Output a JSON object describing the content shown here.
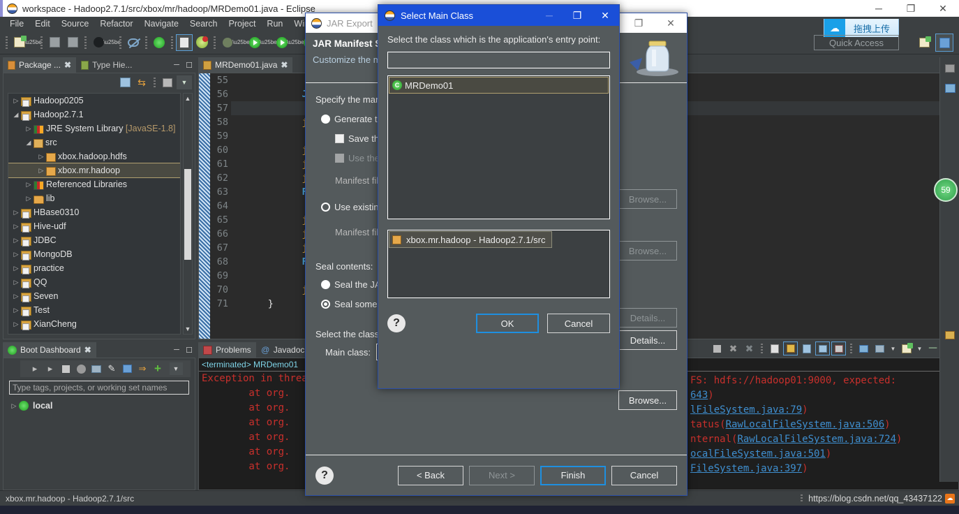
{
  "window": {
    "title": "workspace - Hadoop2.7.1/src/xbox/mr/hadoop/MRDemo01.java - Eclipse",
    "minimize": "─",
    "restore": "❐",
    "close": "✕"
  },
  "menu": [
    "File",
    "Edit",
    "Source",
    "Refactor",
    "Navigate",
    "Search",
    "Project",
    "Run",
    "Wind"
  ],
  "quick_access": {
    "label": "Quick Access"
  },
  "baidu_chip": {
    "label": "拖拽上传",
    "icon": "cloud-icon"
  },
  "badge": {
    "value": "59"
  },
  "package_explorer": {
    "tabs": [
      {
        "label": "Package ...",
        "active": true,
        "close": "✖"
      },
      {
        "label": "Type Hie...",
        "active": false
      }
    ],
    "tree": [
      {
        "indent": 0,
        "arrow": "▷",
        "icon": "project-icon",
        "label": "Hadoop0205",
        "selected": false
      },
      {
        "indent": 0,
        "arrow": "◢",
        "icon": "project-icon",
        "label": "Hadoop2.7.1",
        "selected": false
      },
      {
        "indent": 1,
        "arrow": "▷",
        "icon": "library-icon",
        "label": "JRE System Library ",
        "dim": "[JavaSE-1.8]",
        "selected": false
      },
      {
        "indent": 1,
        "arrow": "◢",
        "icon": "source-folder-icon",
        "label": "src",
        "selected": false
      },
      {
        "indent": 2,
        "arrow": "▷",
        "icon": "package-icon",
        "label": "xbox.hadoop.hdfs",
        "selected": false
      },
      {
        "indent": 2,
        "arrow": "▷",
        "icon": "package-icon",
        "label": "xbox.mr.hadoop",
        "selected": true
      },
      {
        "indent": 1,
        "arrow": "▷",
        "icon": "library-icon",
        "label": "Referenced Libraries",
        "selected": false
      },
      {
        "indent": 1,
        "arrow": "▷",
        "icon": "folder-icon",
        "label": "lib",
        "selected": false
      },
      {
        "indent": 0,
        "arrow": "▷",
        "icon": "project-icon",
        "label": "HBase0310",
        "selected": false
      },
      {
        "indent": 0,
        "arrow": "▷",
        "icon": "project-icon",
        "label": "Hive-udf",
        "selected": false
      },
      {
        "indent": 0,
        "arrow": "▷",
        "icon": "project-icon",
        "label": "JDBC",
        "selected": false
      },
      {
        "indent": 0,
        "arrow": "▷",
        "icon": "project-icon",
        "label": "MongoDB",
        "selected": false
      },
      {
        "indent": 0,
        "arrow": "▷",
        "icon": "project-icon",
        "label": "practice",
        "selected": false
      },
      {
        "indent": 0,
        "arrow": "▷",
        "icon": "project-icon",
        "label": "QQ",
        "selected": false
      },
      {
        "indent": 0,
        "arrow": "▷",
        "icon": "project-icon",
        "label": "Seven",
        "selected": false
      },
      {
        "indent": 0,
        "arrow": "▷",
        "icon": "project-icon",
        "label": "Test",
        "selected": false
      },
      {
        "indent": 0,
        "arrow": "▷",
        "icon": "project-icon",
        "label": "XianCheng",
        "selected": false
      }
    ]
  },
  "boot_dashboard": {
    "tab_label": "Boot Dashboard",
    "tab_close": "✖",
    "filter_placeholder": "Type tags, projects, or working set names",
    "items": [
      {
        "arrow": "▷",
        "label": "local"
      }
    ]
  },
  "editor": {
    "tab_label": "MRDemo01.java",
    "tab_close": "✖",
    "lines": [
      {
        "n": "55",
        "text": "",
        "hl": false
      },
      {
        "n": "56",
        "text": "Job",
        "kind": "kw",
        "hl": false
      },
      {
        "n": "57",
        "text": "",
        "hl": true
      },
      {
        "n": "58",
        "text": "job",
        "kind": "id",
        "hl": false
      },
      {
        "n": "59",
        "text": "",
        "hl": false
      },
      {
        "n": "60",
        "text": "job",
        "kind": "id",
        "hl": false
      },
      {
        "n": "61",
        "text": "job",
        "kind": "id",
        "hl": false
      },
      {
        "n": "62",
        "text": "job",
        "kind": "id",
        "hl": false
      },
      {
        "n": "63",
        "text": "Fil",
        "kind": "kw",
        "hl": false
      },
      {
        "n": "64",
        "text": "",
        "hl": false
      },
      {
        "n": "65",
        "text": "job",
        "kind": "id",
        "hl": false
      },
      {
        "n": "66",
        "text": "job",
        "kind": "id",
        "hl": false
      },
      {
        "n": "67",
        "text": "job",
        "kind": "id",
        "hl": false
      },
      {
        "n": "68",
        "text": "Fil",
        "kind": "kw",
        "hl": false
      },
      {
        "n": "69",
        "text": "",
        "hl": false
      },
      {
        "n": "70",
        "text": "job",
        "kind": "id",
        "hl": false
      },
      {
        "n": "71",
        "text": "}",
        "kind": "pl",
        "hl": false
      }
    ]
  },
  "console": {
    "tabs": [
      {
        "label": "Problems",
        "active": false
      },
      {
        "label": "Javadoc",
        "active": false
      }
    ],
    "header": "<terminated> MRDemo01",
    "lines": [
      "Exception in thread",
      "        at org.",
      "        at org.",
      "        at org.",
      "        at org.",
      "        at org.",
      "        at org."
    ],
    "right_lines": [
      {
        "pre": "FS: hdfs://hadoop01:9000, expected:",
        "link": "",
        "post": ""
      },
      {
        "pre": "",
        "link": "643",
        "post": ")"
      },
      {
        "pre": "",
        "link": "lFileSystem.java:79",
        "post": ")"
      },
      {
        "pre": "tatus(",
        "link": "RawLocalFileSystem.java:506",
        "post": ")"
      },
      {
        "pre": "nternal(",
        "link": "RawLocalFileSystem.java:724",
        "post": ")"
      },
      {
        "pre": "",
        "link": "ocalFileSystem.java:501",
        "post": ")"
      },
      {
        "pre": "",
        "link": "FileSystem.java:397",
        "post": ")"
      }
    ]
  },
  "status_bar": {
    "left": "xbox.mr.hadoop - Hadoop2.7.1/src",
    "blog_url": "https://blog.csdn.net/qq_43437122"
  },
  "jar_export": {
    "title": "JAR Export",
    "heading": "JAR Manifest Sp",
    "subheading": "Customize the m",
    "manifest_section_label": "Specify the mani",
    "generate_radio_label": "Generate the",
    "save_checkbox_label": "Save the ",
    "use_sealed_checkbox_label": "Use the s",
    "manifest_file_label_1": "Manifest file",
    "use_existing_radio_label": "Use existing",
    "manifest_file_label_2": "Manifest file",
    "seal_contents_label": "Seal contents:",
    "seal_jar_radio_label": "Seal the JAR",
    "seal_some_radio_label": "Seal some pa",
    "select_class_label": "Select the class o",
    "main_class_label": "Main class:",
    "browse_1": "Browse...",
    "browse_2": "Browse...",
    "details_1": "Details...",
    "details_2": "Details...",
    "browse_3": "Browse...",
    "back": "< Back",
    "next": "Next >",
    "finish": "Finish",
    "cancel": "Cancel",
    "help": "?",
    "minimize": "─",
    "restore": "❐",
    "close": "✕"
  },
  "select_main_class": {
    "title": "Select Main Class",
    "prompt": "Select the class which is the application's entry point:",
    "filter_value": "",
    "classes": [
      {
        "label": "MRDemo01",
        "icon": "java-class-icon"
      }
    ],
    "packages": [
      {
        "label": "xbox.mr.hadoop - Hadoop2.7.1/src",
        "icon": "package-icon"
      }
    ],
    "ok": "OK",
    "cancel": "Cancel",
    "help": "?",
    "minimize": "─",
    "restore": "❐",
    "close": "✕"
  },
  "colors": {
    "accent_blue": "#1a4fd8",
    "dialog_bg": "#545a5c",
    "editor_bg": "#2b2b2b",
    "error_red": "#c9302c",
    "link_blue": "#3f8fd0"
  }
}
